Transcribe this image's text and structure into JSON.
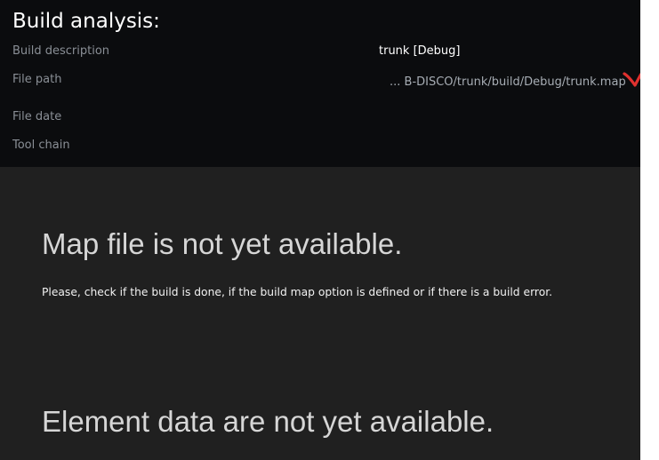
{
  "build_analysis": {
    "title": "Build analysis:",
    "fields": [
      {
        "label": "Build description",
        "value": "trunk [Debug]"
      },
      {
        "label": "File path",
        "value": "... B-DISCO/trunk/build/Debug/trunk.map"
      },
      {
        "label": "File date",
        "value": ""
      },
      {
        "label": "Tool chain",
        "value": ""
      }
    ],
    "check_icon": "checkmark-icon",
    "check_color": "#e0312f"
  },
  "map_file": {
    "heading": "Map file is not yet available.",
    "message": "Please, check if the build is done, if the build map option is defined or if there is a build error."
  },
  "element_data": {
    "heading": "Element data are not yet available."
  },
  "colors": {
    "header_background": "#0b0c0e",
    "content_background": "#202020"
  }
}
